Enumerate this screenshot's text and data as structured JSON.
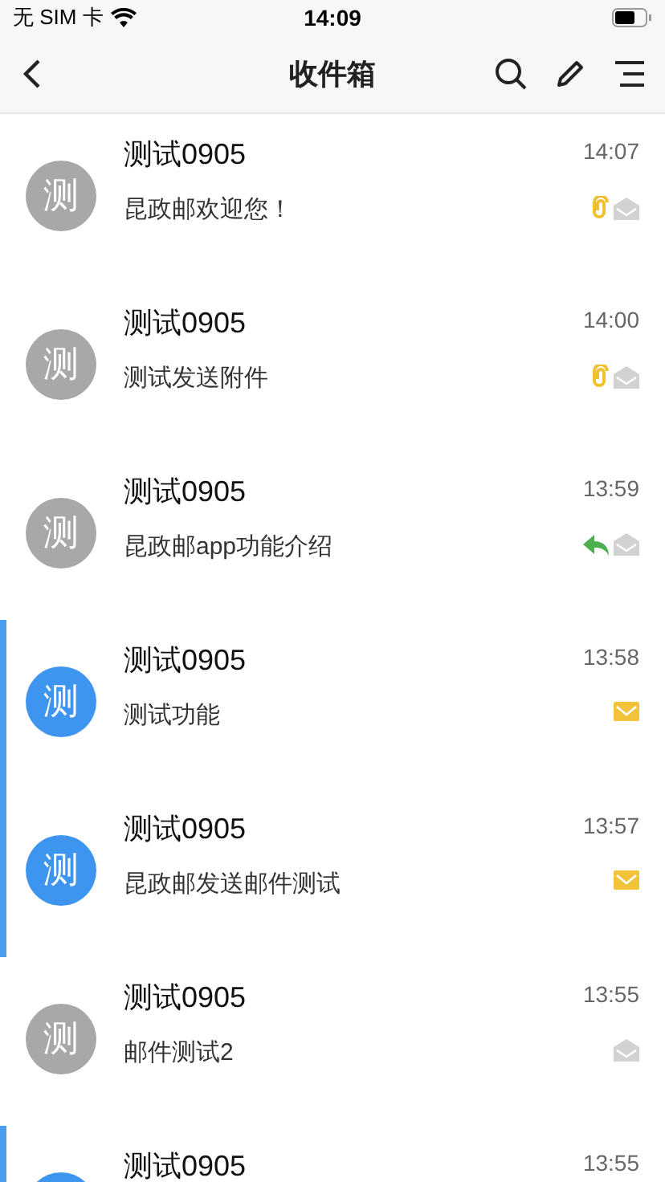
{
  "status_bar": {
    "carrier": "无 SIM 卡",
    "time": "14:09"
  },
  "nav": {
    "title": "收件箱"
  },
  "messages": [
    {
      "sender": "测试0905",
      "avatar": "测",
      "preview": "昆政邮欢迎您！",
      "time": "14:07",
      "unread": false,
      "attachment": true,
      "replied": false
    },
    {
      "sender": "测试0905",
      "avatar": "测",
      "preview": "测试发送附件",
      "time": "14:00",
      "unread": false,
      "attachment": true,
      "replied": false
    },
    {
      "sender": "测试0905",
      "avatar": "测",
      "preview": "昆政邮app功能介绍",
      "time": "13:59",
      "unread": false,
      "attachment": false,
      "replied": true
    },
    {
      "sender": "测试0905",
      "avatar": "测",
      "preview": "测试功能",
      "time": "13:58",
      "unread": true,
      "attachment": false,
      "replied": false
    },
    {
      "sender": "测试0905",
      "avatar": "测",
      "preview": "昆政邮发送邮件测试",
      "time": "13:57",
      "unread": true,
      "attachment": false,
      "replied": false
    },
    {
      "sender": "测试0905",
      "avatar": "测",
      "preview": "邮件测试2",
      "time": "13:55",
      "unread": false,
      "attachment": false,
      "replied": false
    },
    {
      "sender": "测试0905",
      "time": "13:55",
      "unread": true
    }
  ]
}
